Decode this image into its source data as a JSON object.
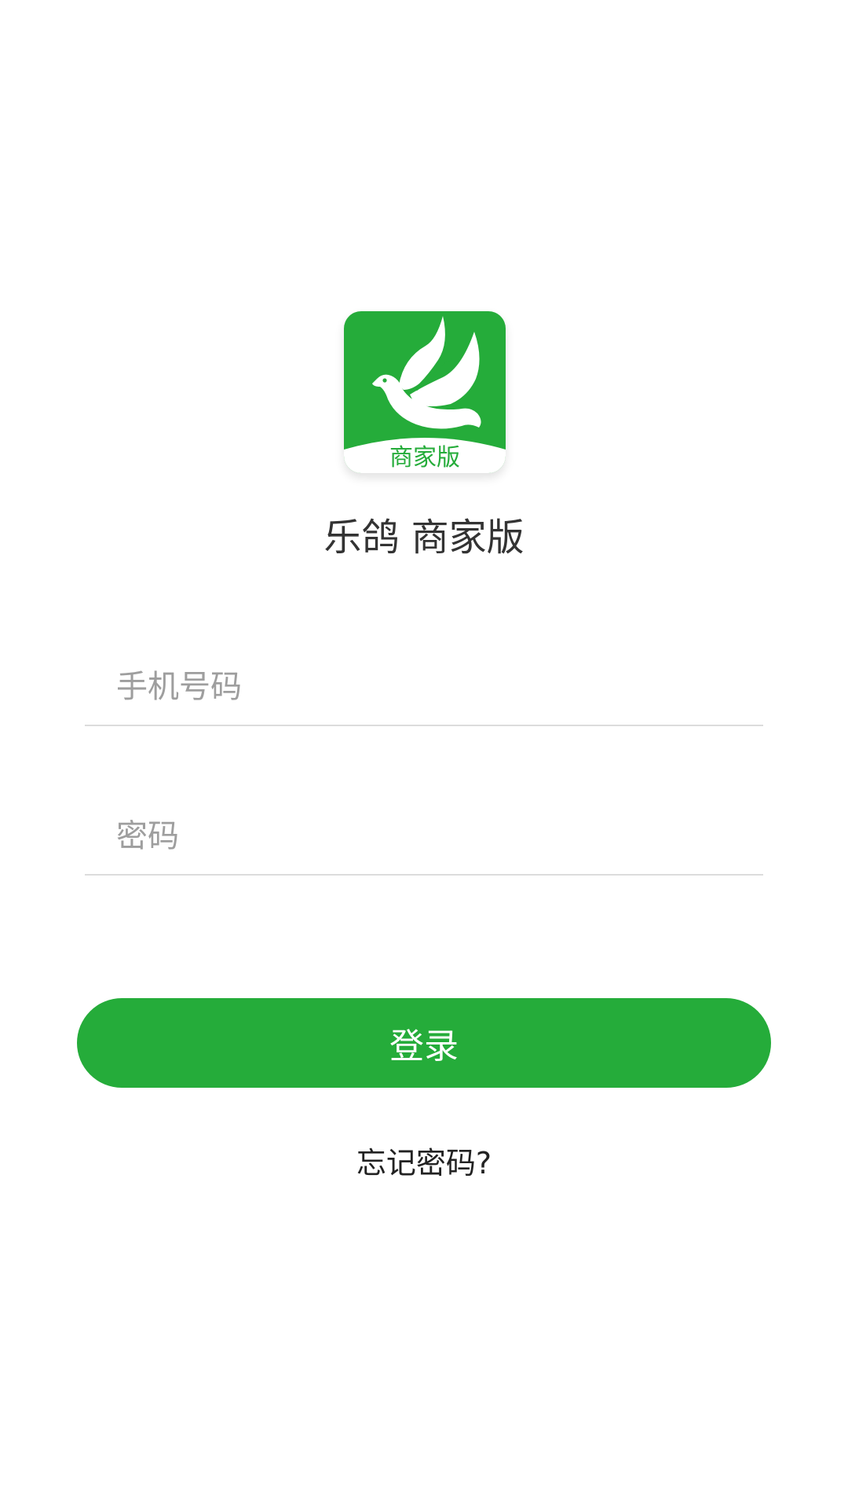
{
  "app": {
    "logo_badge_text": "商家版",
    "title": "乐鸽 商家版",
    "brand_color": "#25ac3a"
  },
  "form": {
    "phone_placeholder": "手机号码",
    "password_placeholder": "密码",
    "login_label": "登录",
    "forgot_label": "忘记密码?"
  }
}
